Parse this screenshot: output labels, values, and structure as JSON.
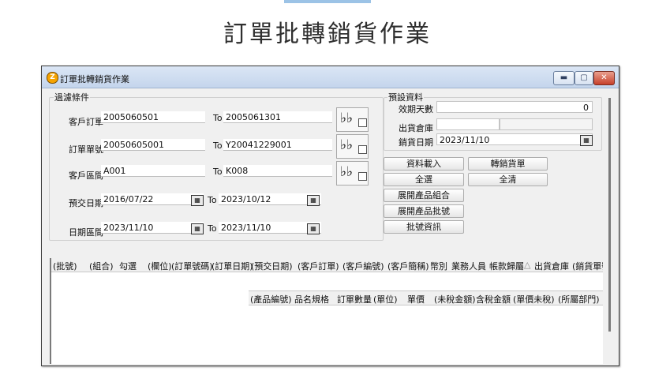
{
  "page_title": "訂單批轉銷貨作業",
  "window": {
    "title": "訂單批轉銷貨作業",
    "icon": "app-logo-icon",
    "controls": {
      "minimize": "▬",
      "maximize": "▢",
      "close": "✕"
    }
  },
  "filter": {
    "group_label": "過濾條件",
    "to_label": "To",
    "rows": [
      {
        "label": "客戶訂單",
        "from": "2005060501",
        "to": "2005061301"
      },
      {
        "label": "訂單單號",
        "from": "20050605001",
        "to": "Y20041229001"
      },
      {
        "label": "客戶區間",
        "from": "A001",
        "to": "K008"
      },
      {
        "label": "預交日期",
        "from": "2016/07/22",
        "to": "2023/10/12"
      },
      {
        "label": "日期區間",
        "from": "2023/11/10",
        "to": "2023/11/10"
      }
    ]
  },
  "defaults": {
    "group_label": "預設資料",
    "valid_days_label": "效期天數",
    "valid_days_value": "0",
    "warehouse_label": "出貨倉庫",
    "warehouse_value": "",
    "sales_date_label": "銷貨日期",
    "sales_date_value": "2023/11/10"
  },
  "buttons": {
    "load": "資料載入",
    "convert": "轉銷貨單",
    "select_all": "全選",
    "clear_all": "全清",
    "expand_combo": "展開產品組合",
    "expand_batch": "展開產品批號",
    "batch_info": "批號資訊"
  },
  "main_columns": [
    "(批號)",
    "(組合)",
    "勾選",
    "(欄位)",
    "(訂單號碼)",
    "(訂單日期)",
    "(預交日期)",
    "(客戶訂單)",
    "(客戶編號)",
    "(客戶簡稱)",
    "幣別",
    "業務人員",
    "帳款歸屬",
    "△",
    "出貨倉庫",
    "(銷貨單號"
  ],
  "detail_columns": [
    "(產品編號)",
    "品名規格",
    "訂單數量",
    "(單位)",
    "單價",
    "(未稅金額)",
    "含稅金額",
    "(單價未稅)",
    "(所屬部門)"
  ],
  "colors": {
    "titlebar": "#c4d5ec",
    "close": "#c7402a",
    "accent_bar": "#9cc3e6"
  }
}
